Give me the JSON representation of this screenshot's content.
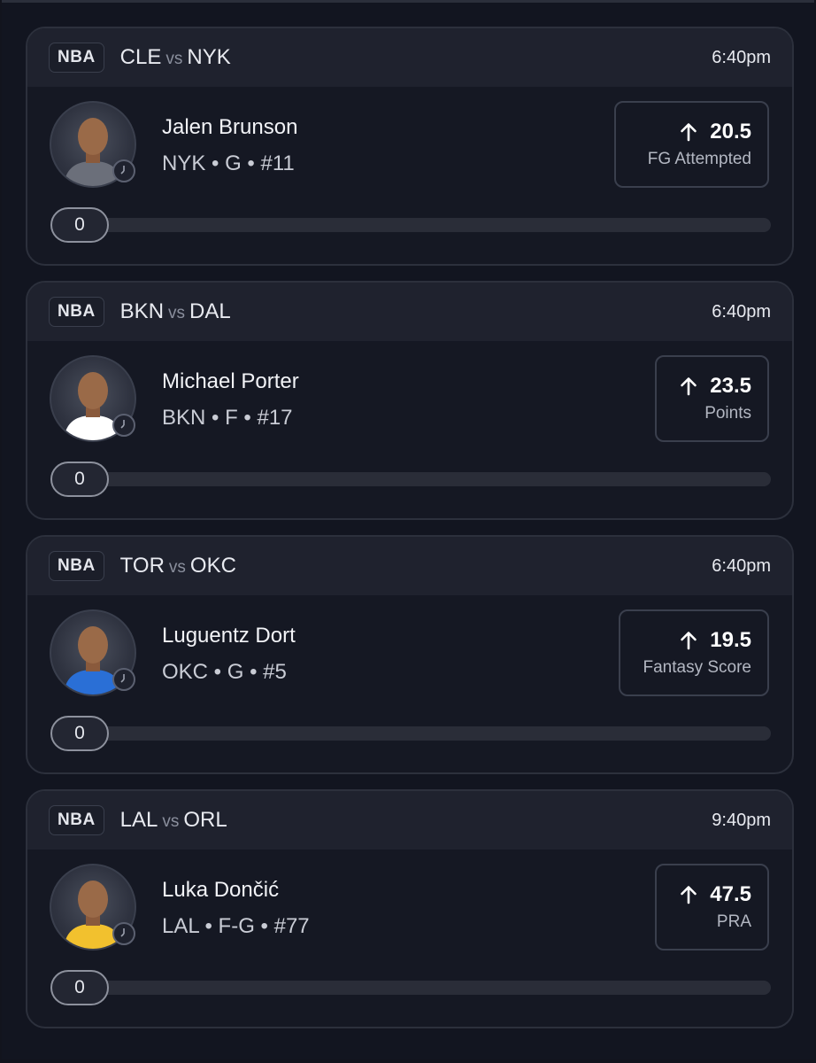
{
  "cards": [
    {
      "league": "NBA",
      "home": "CLE",
      "vs": "vs",
      "away": "NYK",
      "time": "6:40pm",
      "player": "Jalen Brunson",
      "meta": "NYK • G • #11",
      "line": "20.5",
      "stat": "FG Attempted",
      "progress_value": "0",
      "progress_fraction": 0,
      "avatar_jersey": "#6b6f7a"
    },
    {
      "league": "NBA",
      "home": "BKN",
      "vs": "vs",
      "away": "DAL",
      "time": "6:40pm",
      "player": "Michael Porter",
      "meta": "BKN • F • #17",
      "line": "23.5",
      "stat": "Points",
      "progress_value": "0",
      "progress_fraction": 0,
      "avatar_jersey": "#ffffff"
    },
    {
      "league": "NBA",
      "home": "TOR",
      "vs": "vs",
      "away": "OKC",
      "time": "6:40pm",
      "player": "Luguentz Dort",
      "meta": "OKC • G • #5",
      "line": "19.5",
      "stat": "Fantasy Score",
      "progress_value": "0",
      "progress_fraction": 0,
      "avatar_jersey": "#2a6fd6"
    },
    {
      "league": "NBA",
      "home": "LAL",
      "vs": "vs",
      "away": "ORL",
      "time": "9:40pm",
      "player": "Luka Dončić",
      "meta": "LAL • F-G • #77",
      "line": "47.5",
      "stat": "PRA",
      "progress_value": "0",
      "progress_fraction": 0,
      "avatar_jersey": "#f2c12e"
    }
  ],
  "icons": {
    "prop_direction": "arrow-up-icon",
    "schedule": "clock-icon",
    "player": "avatar"
  }
}
